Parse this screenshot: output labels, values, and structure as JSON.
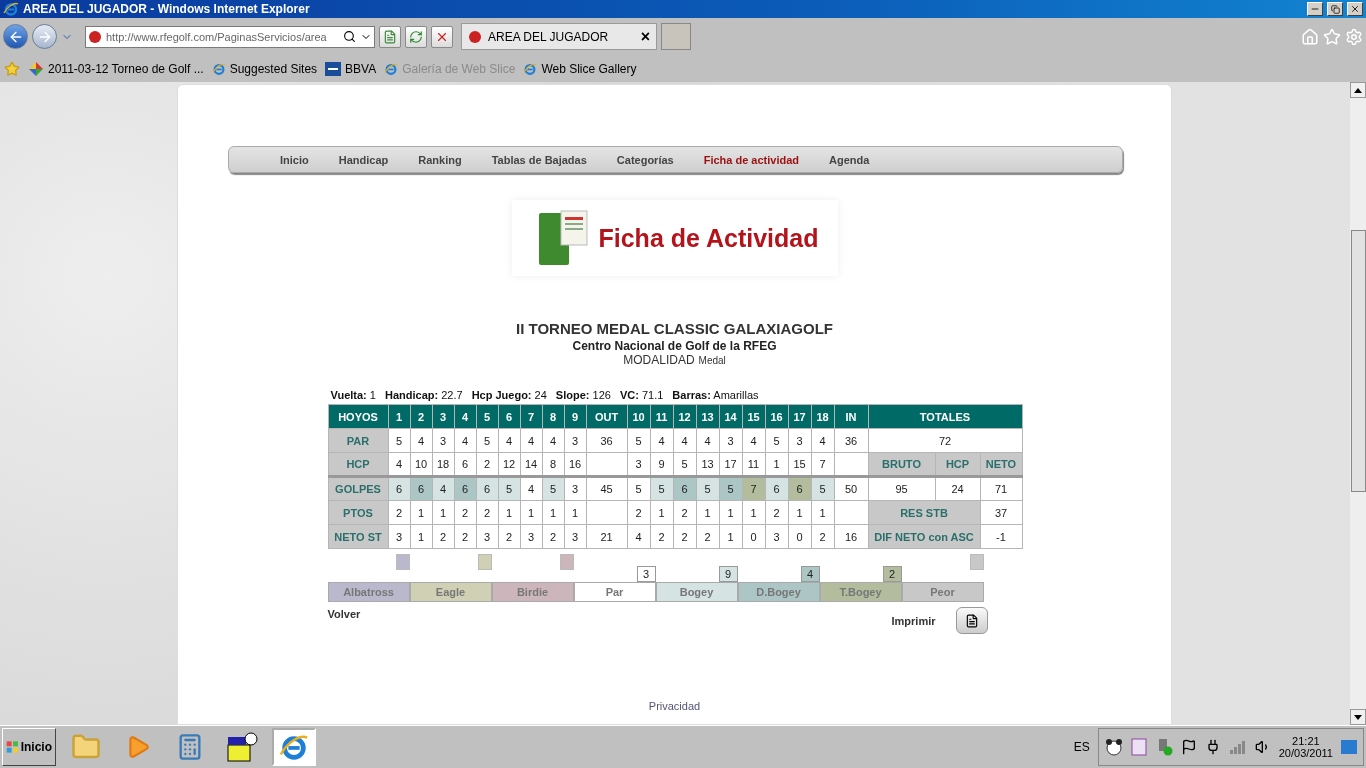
{
  "window": {
    "title": "AREA DEL JUGADOR - Windows Internet Explorer"
  },
  "browser": {
    "address": "http://www.rfegolf.com/PaginasServicios/area",
    "tab": {
      "label": "AREA DEL JUGADOR",
      "close": "×"
    },
    "favorites": [
      {
        "label": "2011-03-12 Torneo de Golf ...",
        "kind": "photos",
        "disabled": false
      },
      {
        "label": "Suggested Sites",
        "kind": "ie",
        "disabled": false
      },
      {
        "label": "BBVA",
        "kind": "bank",
        "disabled": false
      },
      {
        "label": "Galería de Web Slice",
        "kind": "ie",
        "disabled": true
      },
      {
        "label": "Web Slice Gallery",
        "kind": "ie",
        "disabled": false
      }
    ]
  },
  "nav": [
    {
      "label": "Inicio",
      "selected": false
    },
    {
      "label": "Handicap",
      "selected": false
    },
    {
      "label": "Ranking",
      "selected": false
    },
    {
      "label": "Tablas de Bajadas",
      "selected": false
    },
    {
      "label": "Categorías",
      "selected": false
    },
    {
      "label": "Ficha de actividad",
      "selected": true
    },
    {
      "label": "Agenda",
      "selected": false
    }
  ],
  "banner": {
    "title": "Ficha de Actividad"
  },
  "tournament": {
    "name": "II TORNEO MEDAL CLASSIC GALAXIAGOLF",
    "venue": "Centro Nacional de Golf de la RFEG",
    "mode_label": "MODALIDAD",
    "mode": "Medal"
  },
  "round_info": [
    {
      "label": "Vuelta:",
      "value": "1"
    },
    {
      "label": "Handicap:",
      "value": "22.7"
    },
    {
      "label": "Hcp Juego:",
      "value": "24"
    },
    {
      "label": "Slope:",
      "value": "126"
    },
    {
      "label": "VC:",
      "value": "71.1"
    },
    {
      "label": "Barras:",
      "value": "Amarillas"
    }
  ],
  "scorecard": {
    "header": {
      "label": "HOYOS",
      "holes": [
        "1",
        "2",
        "3",
        "4",
        "5",
        "6",
        "7",
        "8",
        "9",
        "10",
        "11",
        "12",
        "13",
        "14",
        "15",
        "16",
        "17",
        "18"
      ],
      "out": "OUT",
      "in": "IN",
      "totals": "TOTALES"
    },
    "rows": [
      {
        "label": "PAR",
        "holes": [
          "5",
          "4",
          "3",
          "4",
          "5",
          "4",
          "4",
          "4",
          "3",
          "5",
          "4",
          "4",
          "4",
          "3",
          "4",
          "5",
          "3",
          "4"
        ],
        "out": "36",
        "in": "36",
        "totals": [
          {
            "text": "72",
            "kind": "value"
          }
        ]
      },
      {
        "label": "HCP",
        "holes": [
          "4",
          "10",
          "18",
          "6",
          "2",
          "12",
          "14",
          "8",
          "16",
          "3",
          "9",
          "5",
          "13",
          "17",
          "11",
          "1",
          "15",
          "7"
        ],
        "totals": [
          {
            "text": "BRUTO",
            "kind": "label"
          },
          {
            "text": "HCP",
            "kind": "label"
          },
          {
            "text": "NETO",
            "kind": "label"
          }
        ]
      },
      {
        "label": "GOLPES",
        "holes": [
          {
            "value": "6",
            "color": "#d5e3e3"
          },
          {
            "value": "6",
            "color": "#abc6c5"
          },
          {
            "value": "4",
            "color": "#d5e3e3"
          },
          {
            "value": "6",
            "color": "#abc6c5"
          },
          {
            "value": "6",
            "color": "#d5e3e3"
          },
          {
            "value": "5",
            "color": "#d5e3e3"
          },
          {
            "value": "4",
            "color": "#ffffff"
          },
          {
            "value": "5",
            "color": "#d5e3e3"
          },
          {
            "value": "3",
            "color": "#ffffff"
          },
          {
            "value": "5",
            "color": "#ffffff"
          },
          {
            "value": "5",
            "color": "#d5e3e3"
          },
          {
            "value": "6",
            "color": "#abc6c5"
          },
          {
            "value": "5",
            "color": "#d5e3e3"
          },
          {
            "value": "5",
            "color": "#abc6c5"
          },
          {
            "value": "7",
            "color": "#b3bd9e"
          },
          {
            "value": "6",
            "color": "#d5e3e3"
          },
          {
            "value": "6",
            "color": "#b3bd9e"
          },
          {
            "value": "5",
            "color": "#d5e3e3"
          }
        ],
        "out": "45",
        "in": "50",
        "totals": [
          {
            "text": "95",
            "kind": "value"
          },
          {
            "text": "24",
            "kind": "value"
          },
          {
            "text": "71",
            "kind": "value"
          }
        ]
      },
      {
        "label": "PTOS",
        "holes": [
          "2",
          "1",
          "1",
          "2",
          "2",
          "1",
          "1",
          "1",
          "1",
          "2",
          "1",
          "2",
          "1",
          "1",
          "1",
          "2",
          "1",
          "1"
        ],
        "totals": [
          {
            "text": "RES STB",
            "kind": "label"
          },
          {
            "text": "37",
            "kind": "value"
          }
        ]
      },
      {
        "label": "NETO ST",
        "holes": [
          "3",
          "1",
          "2",
          "2",
          "3",
          "2",
          "3",
          "2",
          "3",
          "4",
          "2",
          "2",
          "2",
          "1",
          "0",
          "3",
          "0",
          "2"
        ],
        "out": "21",
        "in": "16",
        "totals": [
          {
            "text": "DIF NETO con ASC",
            "kind": "label"
          },
          {
            "text": "-1",
            "kind": "value"
          }
        ]
      }
    ]
  },
  "legend": [
    {
      "label": "Albatross",
      "color": "#b9b8cc"
    },
    {
      "label": "Eagle",
      "color": "#cfd0b4"
    },
    {
      "label": "Birdie",
      "color": "#cdb6bb"
    },
    {
      "label": "Par",
      "color": "#ffffff",
      "count": "3"
    },
    {
      "label": "Bogey",
      "color": "#d5e3e3",
      "count": "9"
    },
    {
      "label": "D.Bogey",
      "color": "#abc6c5",
      "count": "4"
    },
    {
      "label": "T.Bogey",
      "color": "#b3bd9e",
      "count": "2"
    },
    {
      "label": "Peor",
      "color": "#c8c8c8"
    }
  ],
  "actions": {
    "back": "Volver",
    "print": "Imprimir"
  },
  "footer": {
    "link": "Privacidad"
  },
  "taskbar": {
    "start": "Inicio",
    "language": "ES",
    "time": "21:21",
    "date": "20/03/2011"
  }
}
